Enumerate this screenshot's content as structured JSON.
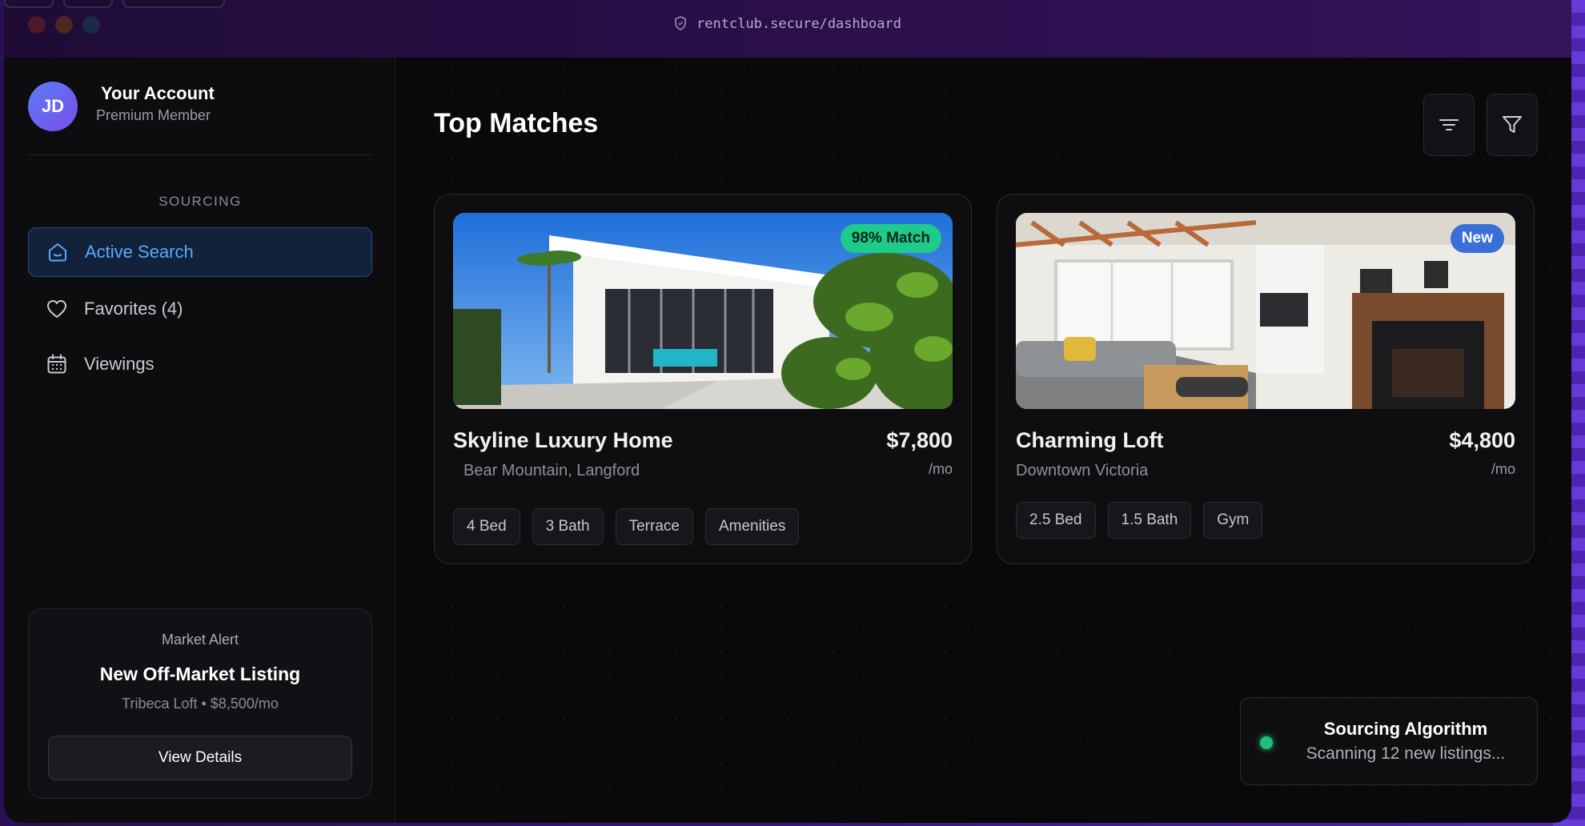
{
  "browser": {
    "url": "rentclub.secure/dashboard",
    "traffic_lights": [
      "#4a1a2a",
      "#4d2620",
      "#1c2a48"
    ]
  },
  "account": {
    "initials": "JD",
    "name": "Your Account",
    "tier": "Premium Member"
  },
  "sidebar": {
    "section_label": "SOURCING",
    "items": [
      {
        "label": "Active Search",
        "icon": "home-icon",
        "active": true
      },
      {
        "label": "Favorites (4)",
        "icon": "heart-icon",
        "active": false
      },
      {
        "label": "Viewings",
        "icon": "calendar-icon",
        "active": false
      }
    ]
  },
  "market_alert": {
    "label": "Market Alert",
    "title": "New Off-Market Listing",
    "detail": "Tribeca Loft • $8,500/mo",
    "button": "View Details"
  },
  "main": {
    "title": "Top Matches",
    "toolbar": [
      "sort-lines-icon",
      "filter-funnel-icon"
    ]
  },
  "listings": [
    {
      "title": "Skyline Luxury Home",
      "location": "Bear Mountain, Langford",
      "price": "$7,800",
      "per": "/mo",
      "badge": "98% Match",
      "badge_color": "#1fcb8a",
      "tags": [
        "4 Bed",
        "3 Bath",
        "Terrace",
        "Amenities"
      ]
    },
    {
      "title": "Charming Loft",
      "location": "Downtown Victoria",
      "price": "$4,800",
      "per": "/mo",
      "badge": "New",
      "badge_color": "#3b6fd8",
      "tags": [
        "2.5 Bed",
        "1.5 Bath",
        "Gym"
      ]
    }
  ],
  "algorithm": {
    "title": "Sourcing Algorithm",
    "status": "Scanning 12 new listings..."
  },
  "colors": {
    "accent": "#5aa8ff",
    "status_green": "#1fbf78"
  }
}
